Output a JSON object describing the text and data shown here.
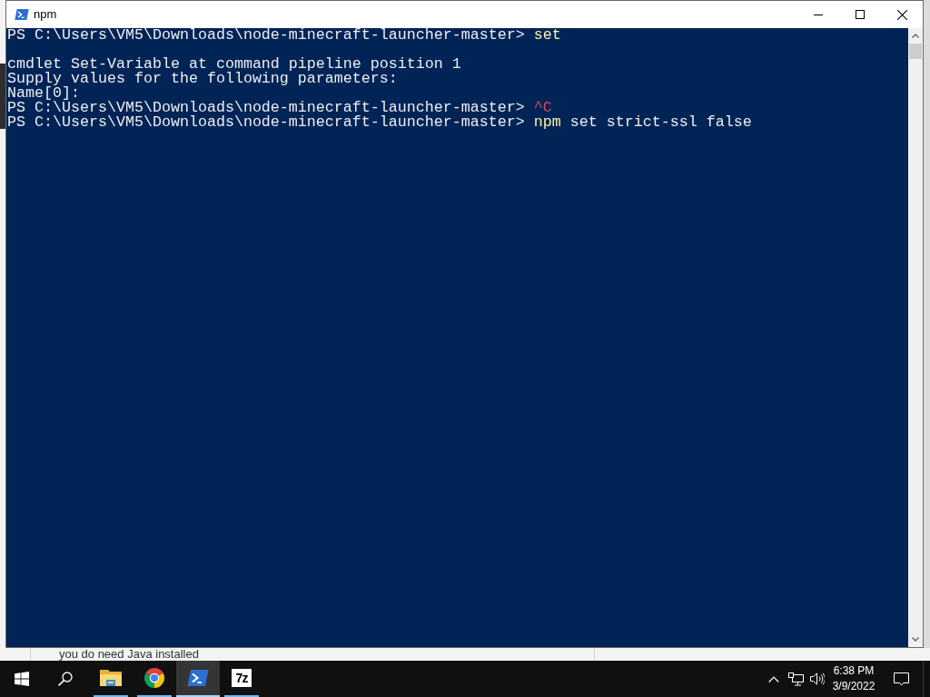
{
  "window": {
    "title": "npm"
  },
  "console": {
    "lines": [
      {
        "kind": "text",
        "segments": [
          {
            "kind": "prompt",
            "text": "PS C:\\Users\\VM5\\Downloads\\node-minecraft-launcher-master>"
          },
          {
            "kind": "command",
            "text": "set"
          }
        ]
      },
      {
        "kind": "blank"
      },
      {
        "kind": "text",
        "segments": [
          {
            "kind": "output",
            "text": "cmdlet Set-Variable at command pipeline position 1"
          }
        ]
      },
      {
        "kind": "text",
        "segments": [
          {
            "kind": "output",
            "text": "Supply values for the following parameters:"
          }
        ]
      },
      {
        "kind": "text",
        "segments": [
          {
            "kind": "output",
            "text": "Name[0]:"
          }
        ]
      },
      {
        "kind": "text",
        "segments": [
          {
            "kind": "prompt",
            "text": "PS C:\\Users\\VM5\\Downloads\\node-minecraft-launcher-master>"
          },
          {
            "kind": "interrupt",
            "text": "^C"
          }
        ]
      },
      {
        "kind": "text",
        "segments": [
          {
            "kind": "prompt",
            "text": "PS C:\\Users\\VM5\\Downloads\\node-minecraft-launcher-master>"
          },
          {
            "kind": "command",
            "text": "npm"
          },
          {
            "kind": "argument",
            "text": "set strict-ssl false"
          }
        ]
      }
    ]
  },
  "background_window": {
    "text": "you do need Java installed"
  },
  "taskbar": {
    "apps": [
      {
        "kind": "folder",
        "running": true,
        "selected": false
      },
      {
        "kind": "browser",
        "running": true,
        "selected": false
      },
      {
        "kind": "terminal",
        "running": true,
        "selected": true
      },
      {
        "kind": "archiver",
        "label": "7z",
        "running": true,
        "selected": false
      }
    ]
  },
  "clock": {
    "time": "6:38 PM",
    "date": "3/9/2022"
  }
}
